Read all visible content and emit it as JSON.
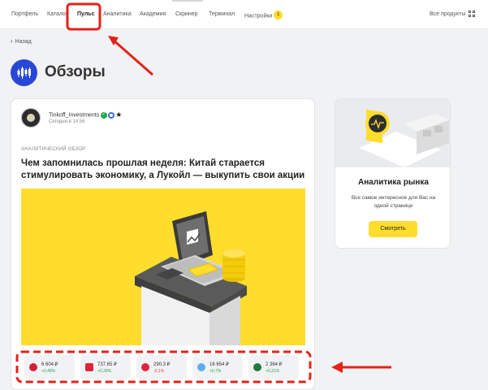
{
  "nav": {
    "items": [
      "Портфель",
      "Каталог",
      "Пульс",
      "Аналитика",
      "Академия",
      "Скринер",
      "Терминал",
      "Настройки"
    ],
    "settings_badge": "1",
    "all_products": "Все продукты",
    "product_icon": "grid-apps-icon"
  },
  "page": {
    "back_label": "Назад",
    "title": "Обзоры",
    "icon": "candlestick-chart-icon"
  },
  "post": {
    "author": "Tinkoff_Investments",
    "date": "Сегодня в 14:56",
    "kind": "АНАЛИТИЧЕСКИЙ ОБЗОР",
    "headline": "Чем запомнилась прошлая неделя: Китай старается стимулировать экономику, а Лукойл — выкупить свои акции",
    "image": "laptop-on-pedestal-with-coins-illustration",
    "tickers": [
      {
        "price": "6 604 ₽",
        "change": "+0,49%",
        "direction": "up",
        "color": "#d51f35",
        "icon": "magnit-logo-icon"
      },
      {
        "price": "737,65 ₽",
        "change": "+0,39%",
        "direction": "up",
        "color": "#e0233d",
        "icon": "lukoil-logo-icon"
      },
      {
        "price": "290,3 ₽",
        "change": "-0,1%",
        "direction": "down",
        "color": "#e0233d",
        "icon": "dots-logo-icon"
      },
      {
        "price": "16 654 ₽",
        "change": "+0,7%",
        "direction": "up",
        "color": "#5ab0e6",
        "icon": "chain-logo-icon"
      },
      {
        "price": "2 364 ₽",
        "change": "+0,21%",
        "direction": "up",
        "color": "#1f7a3c",
        "icon": "bank-logo-icon"
      }
    ]
  },
  "promo": {
    "title": "Аналитика рынка",
    "text": "Все самое интересное для Вас на одной странице",
    "button": "Смотреть",
    "image": "analytics-3d-illustration"
  },
  "colors": {
    "accent": "#ffdd2d",
    "annotation": "#e2231a",
    "up": "#22a84b",
    "down": "#e13f3f"
  }
}
